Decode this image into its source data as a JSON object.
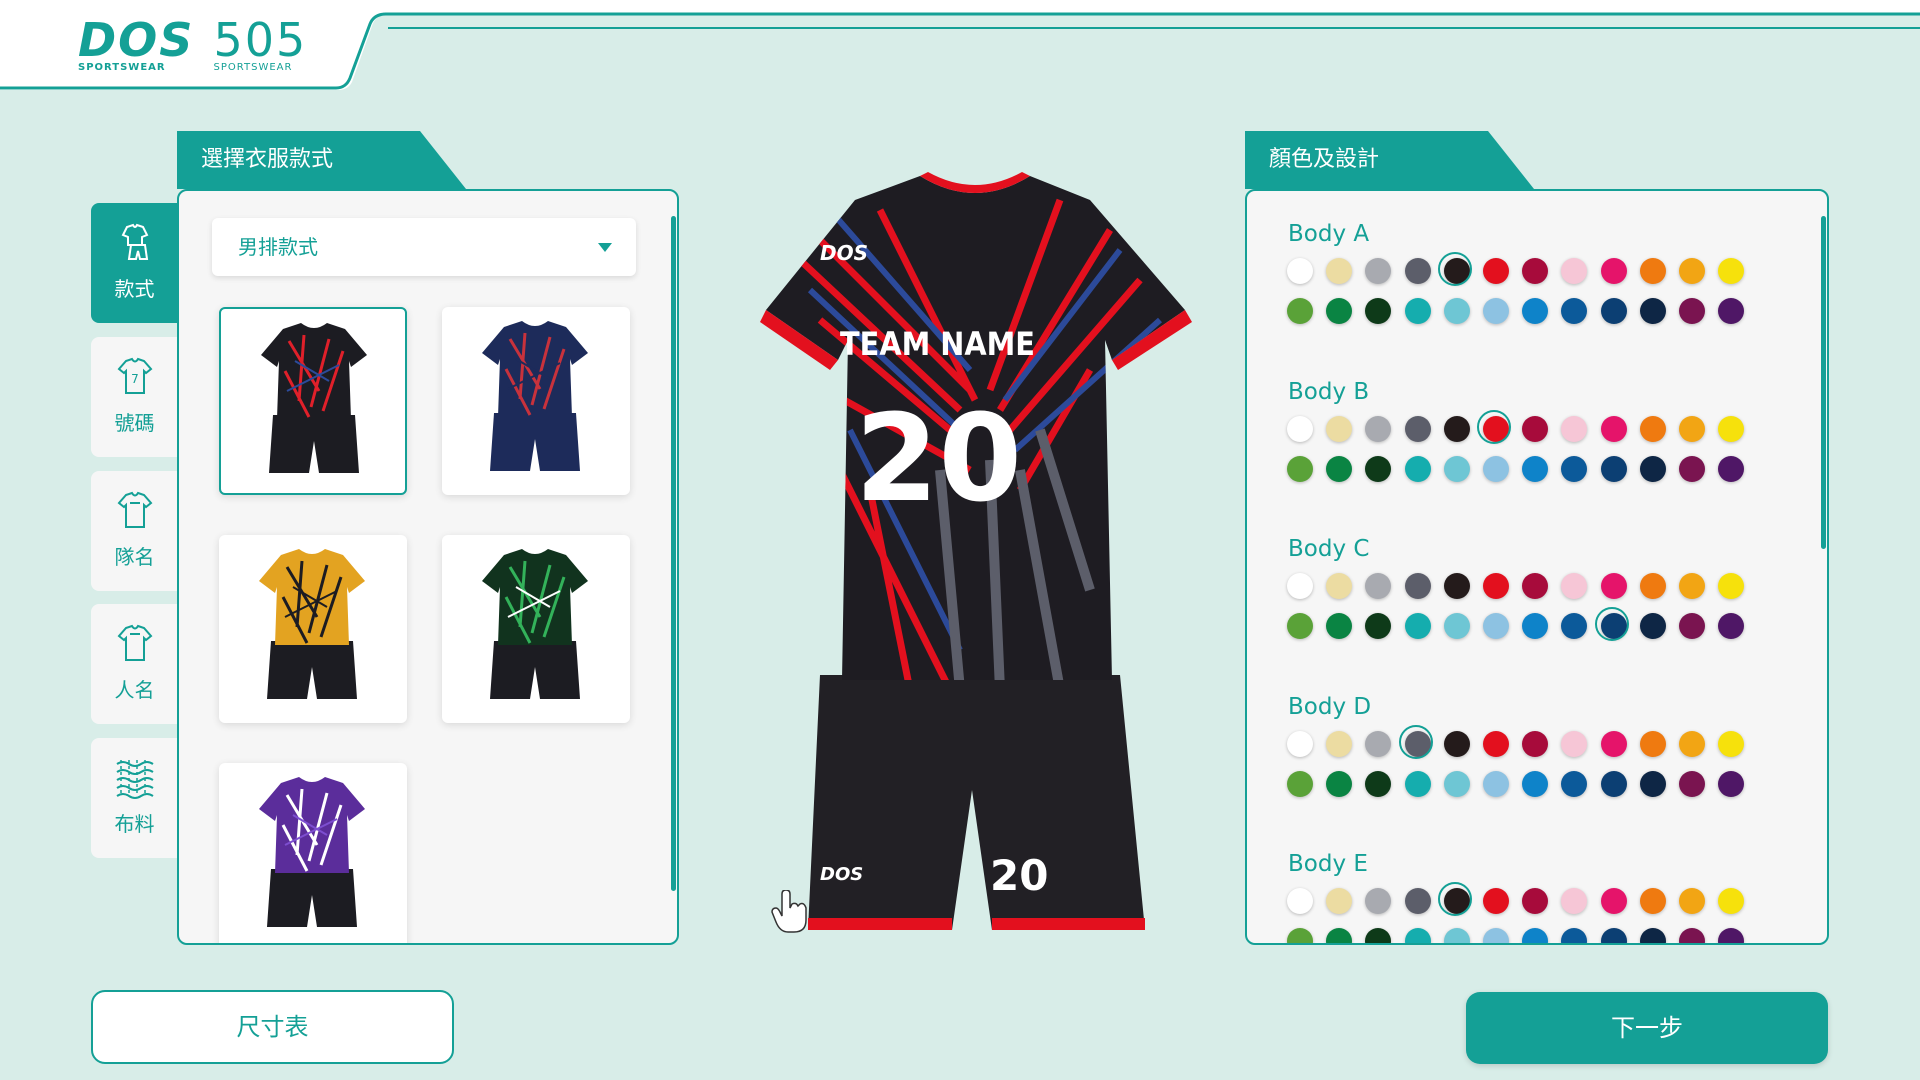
{
  "brand": {
    "logo_main": "DOS",
    "logo_sub": "SPORTSWEAR",
    "logo_alt_main": "505",
    "logo_alt_sub": "SPORTSWEAR"
  },
  "left_panel": {
    "title": "選擇衣服款式",
    "dropdown_value": "男排款式"
  },
  "sidebar": {
    "items": [
      {
        "label": "款式",
        "icon": "clothing-icon"
      },
      {
        "label": "號碼",
        "icon": "number-shirt-icon"
      },
      {
        "label": "隊名",
        "icon": "team-shirt-icon"
      },
      {
        "label": "人名",
        "icon": "name-shirt-icon"
      },
      {
        "label": "布料",
        "icon": "fabric-icon"
      }
    ]
  },
  "styles": [
    {
      "name": "style-1",
      "top": "#1c1c22",
      "accent": "#e0202a",
      "accent2": "#2c4a9a",
      "shorts": "#1c1c22"
    },
    {
      "name": "style-2",
      "top": "#1d2b5a",
      "accent": "#c8323c",
      "accent2": "#1d2b5a",
      "shorts": "#1d2b5a"
    },
    {
      "name": "style-3",
      "top": "#e3a321",
      "accent": "#1c1c22",
      "accent2": "#1c1c22",
      "shorts": "#1c1c22"
    },
    {
      "name": "style-4",
      "top": "#11331e",
      "accent": "#33b25a",
      "accent2": "#ffffff",
      "shorts": "#1c1c22"
    },
    {
      "name": "style-5",
      "top": "#5b2d9b",
      "accent": "#ffffff",
      "accent2": "#7d4ed0",
      "shorts": "#1c1c22"
    }
  ],
  "preview": {
    "team_name": "TEAM NAME",
    "number": "20",
    "logo": "DOS"
  },
  "right_panel": {
    "title": "顏色及設計"
  },
  "palette": {
    "row1": [
      "#ffffff",
      "#ecdca2",
      "#a8aab0",
      "#5c5e6a",
      "#241b1b",
      "#e3101e",
      "#a70b3b",
      "#f6c6d6",
      "#e5146a",
      "#ef7a10",
      "#f2a514",
      "#f6e10c"
    ],
    "row2": [
      "#5aa238",
      "#0a8443",
      "#0e3a19",
      "#15adae",
      "#6ec6d4",
      "#8dc2e2",
      "#0e83c9",
      "#0c5a9a",
      "#0c3f73",
      "#0e2645",
      "#7a1450",
      "#4f1766"
    ]
  },
  "bodies": [
    {
      "label": "Body A",
      "selected_row": 1,
      "selected_index": 4
    },
    {
      "label": "Body B",
      "selected_row": 1,
      "selected_index": 5
    },
    {
      "label": "Body C",
      "selected_row": 2,
      "selected_index": 8
    },
    {
      "label": "Body D",
      "selected_row": 1,
      "selected_index": 3
    },
    {
      "label": "Body E",
      "selected_row": 1,
      "selected_index": 4
    }
  ],
  "buttons": {
    "size_chart": "尺寸表",
    "next": "下一步"
  },
  "colors": {
    "accent": "#14a096",
    "background": "#d8ede8"
  }
}
